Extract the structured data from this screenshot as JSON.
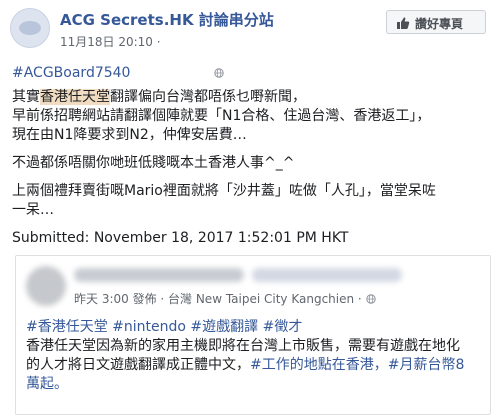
{
  "header": {
    "page_name": "ACG Secrets.HK 討論串分站",
    "timestamp": "11月18日 20:10 · ",
    "like_label": "讚好專頁"
  },
  "post": {
    "hashtag": "#ACGBoard7540",
    "line1_pre": "其實",
    "line1_highlight": "香港任天堂",
    "line1_post": "翻譯偏向台灣都唔係乜嘢新聞，",
    "line2": "早前係招聘網站請翻譯個陣就要「N1合格、住過台灣、香港返工」，",
    "line3": "現在由N1降要求到N2，仲俾安居費…",
    "line4": "不過都係唔關你哋班低賤嘅本土香港人事^_^",
    "line5": "上兩個禮拜賣街嘅Mario裡面就將「沙井蓋」咗做「人孔」，當堂呆咗",
    "line6": "一呆…",
    "submitted": "Submitted: November 18, 2017 1:52:01 PM HKT"
  },
  "shared": {
    "meta": "昨天 3:00 發佈 · 台灣 New Taipei City Kangchien · ",
    "tags": "#香港任天堂 #nintendo #遊戲翻譯 #徵才",
    "text1": "香港任天堂因為新的家用主機即將在台灣上市販售，需要有遊戲在地化",
    "text2_pre": "的人才將日文遊戲翻譯成正體中文，",
    "text2_tags": "#工作的地點在香港，#月薪台幣8",
    "text3": "萬起。"
  }
}
